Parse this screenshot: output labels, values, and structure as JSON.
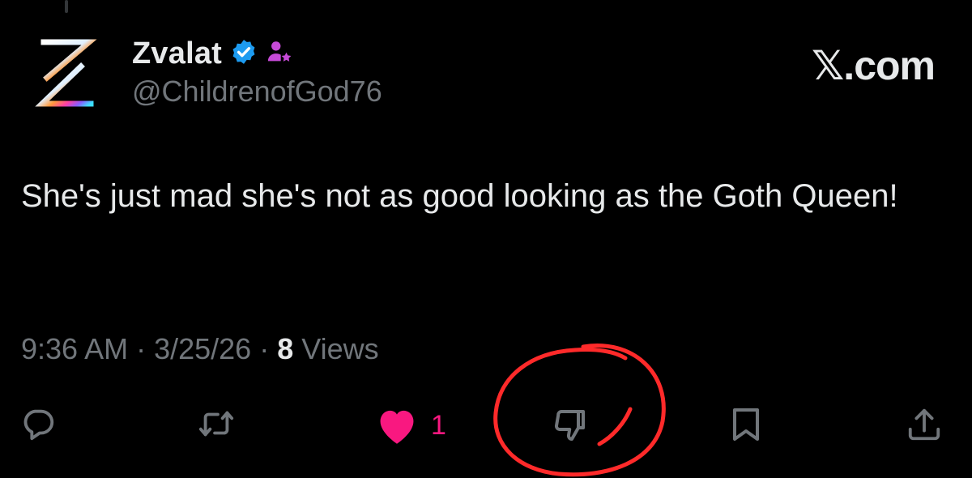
{
  "watermark": "𝕏.com",
  "tweet": {
    "author": {
      "display_name": "Zvalat",
      "handle": "@ChildrenofGod76",
      "verified_icon": "verified-badge-icon",
      "affiliate_icon": "affiliate-user-star-icon",
      "avatar_letter": "Z"
    },
    "text": "She's just mad she's not as good looking as the Goth Queen!",
    "time": "9:36 AM",
    "separator": "·",
    "date": "3/25/26",
    "views_count": "8",
    "views_label": "Views"
  },
  "actions": {
    "reply_icon": "reply-icon",
    "repost_icon": "repost-icon",
    "like_icon": "heart-filled-icon",
    "like_count": "1",
    "dislike_icon": "thumbs-down-icon",
    "bookmark_icon": "bookmark-icon",
    "share_icon": "share-icon"
  },
  "colors": {
    "background": "#000000",
    "text_primary": "#e7e9ea",
    "text_secondary": "#71767b",
    "like_pink": "#f91880",
    "verified_blue": "#1d9bf0",
    "affiliate_purple": "#c64ad7",
    "annotation_red": "#ff2a2a"
  }
}
